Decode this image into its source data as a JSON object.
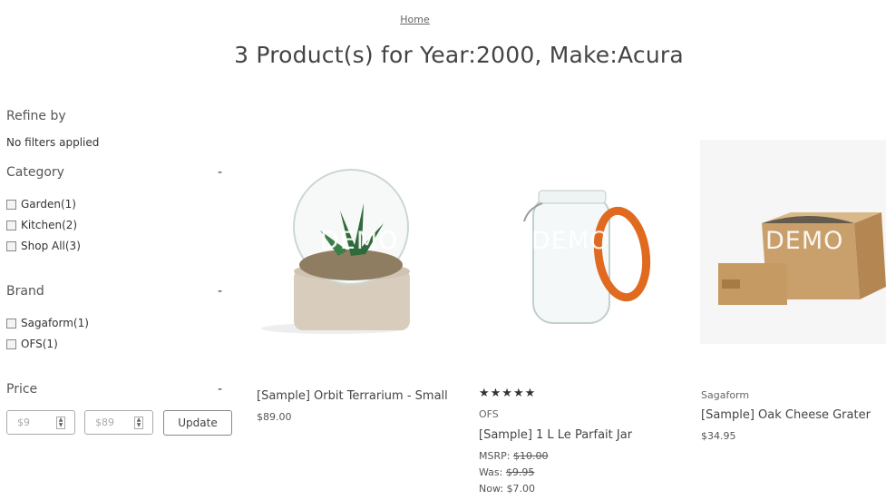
{
  "breadcrumb": {
    "home": "Home"
  },
  "page_title": "3 Product(s) for Year:2000, Make:Acura",
  "sidebar": {
    "refine_heading": "Refine by",
    "no_filters": "No filters applied",
    "category": {
      "title": "Category",
      "toggle": "-",
      "options": [
        "Garden(1)",
        "Kitchen(2)",
        "Shop All(3)"
      ]
    },
    "brand": {
      "title": "Brand",
      "toggle": "-",
      "options": [
        "Sagaform(1)",
        "OFS(1)"
      ]
    },
    "price": {
      "title": "Price",
      "toggle": "-",
      "min_placeholder": "$9",
      "max_placeholder": "$89",
      "update_label": "Update"
    }
  },
  "watermark": "DEMO",
  "products": [
    {
      "brand": "",
      "title": "[Sample] Orbit Terrarium - Small",
      "price": "$89.00"
    },
    {
      "rating": "★★★★★",
      "rating_value": 5,
      "brand": "OFS",
      "title": "[Sample] 1 L Le Parfait Jar",
      "msrp_label": "MSRP:",
      "msrp": "$10.00",
      "was_label": "Was:",
      "was": "$9.95",
      "now_label": "Now:",
      "now": "$7.00"
    },
    {
      "brand": "Sagaform",
      "title": "[Sample] Oak Cheese Grater",
      "price": "$34.95"
    }
  ],
  "colors": {
    "jar_clip": "#e06a1f",
    "wood": "#c9a06b",
    "concrete": "#d8cdbd"
  }
}
